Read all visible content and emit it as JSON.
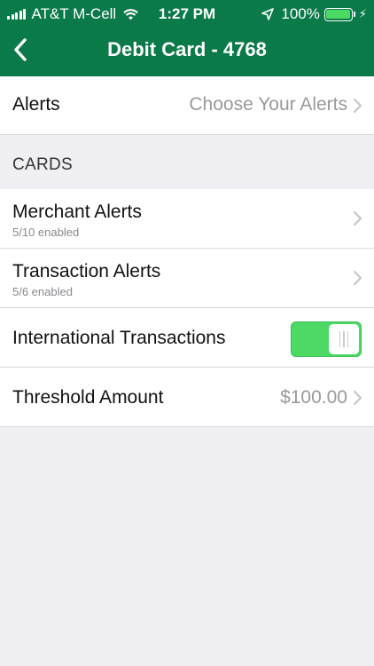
{
  "status_bar": {
    "carrier": "AT&T M-Cell",
    "time": "1:27 PM",
    "battery": "100%"
  },
  "nav": {
    "title": "Debit Card - 4768"
  },
  "alerts_row": {
    "label": "Alerts",
    "value": "Choose Your Alerts"
  },
  "section": {
    "title": "CARDS"
  },
  "merchant": {
    "label": "Merchant Alerts",
    "sub": "5/10 enabled"
  },
  "transaction": {
    "label": "Transaction Alerts",
    "sub": "5/6 enabled"
  },
  "international": {
    "label": "International Transactions",
    "enabled": true
  },
  "threshold": {
    "label": "Threshold Amount",
    "value": "$100.00"
  },
  "colors": {
    "header": "#0a7a48",
    "toggle_on": "#4cd964"
  }
}
